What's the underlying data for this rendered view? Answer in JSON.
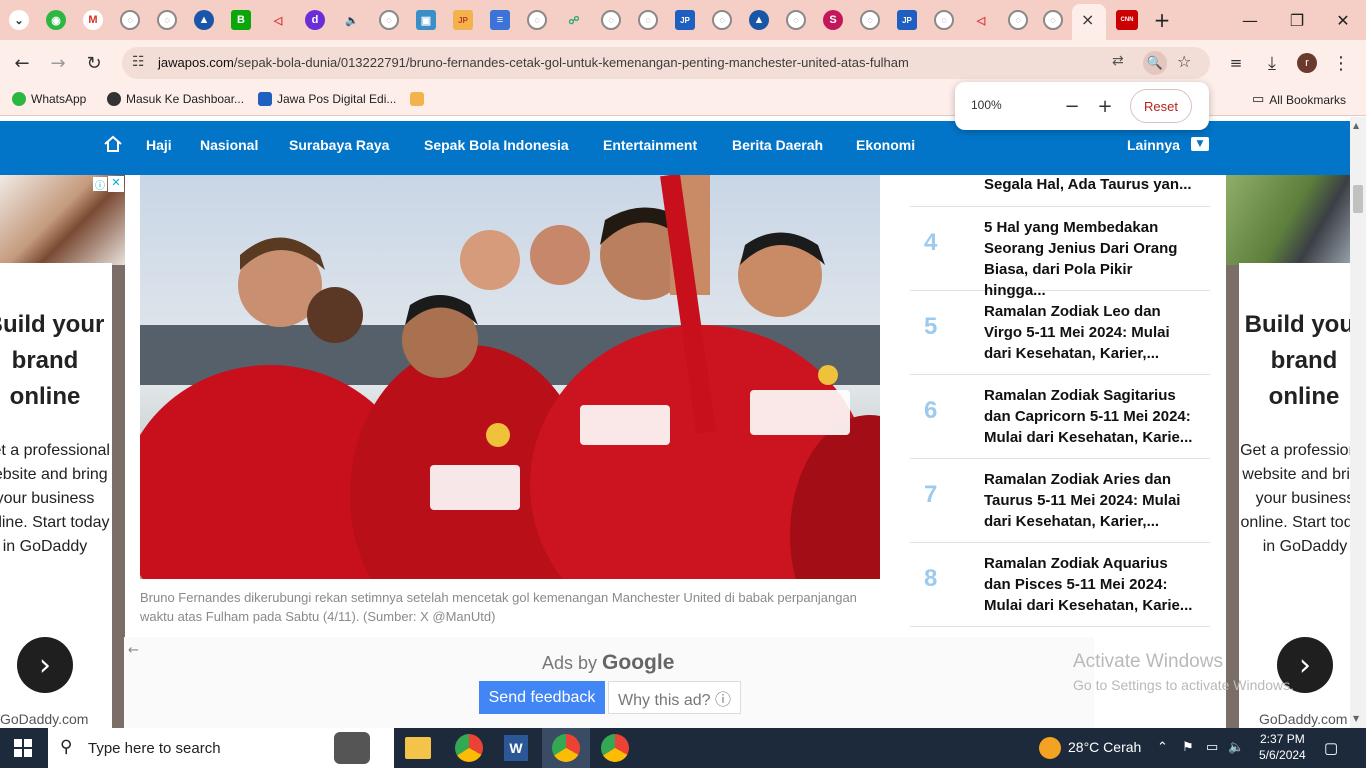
{
  "browser": {
    "active_tab_close": "×",
    "new_tab": "+",
    "tab_badges": [
      "B",
      "d",
      "JP",
      "S",
      "JP",
      "CNN"
    ],
    "url_host": "jawapos.com",
    "url_path": "/sepak-bola-dunia/013222791/bruno-fernandes-cetak-gol-untuk-kemenangan-penting-manchester-united-atas-fulham",
    "profile_initial": "r",
    "bookmarks": [
      "WhatsApp",
      "Masuk Ke Dashboar...",
      "Jawa Pos Digital Edi..."
    ],
    "all_bookmarks": "All Bookmarks",
    "zoom": {
      "level": "100%",
      "reset": "Reset"
    }
  },
  "nav": {
    "items": [
      "Haji",
      "Nasional",
      "Surabaya Raya",
      "Sepak Bola Indonesia",
      "Entertainment",
      "Berita Daerah",
      "Ekonomi"
    ],
    "more": "Lainnya"
  },
  "article": {
    "caption": "Bruno Fernandes dikerubungi rekan setimnya setelah mencetak gol kemenangan Manchester United di babak perpanjangan waktu atas Fulham pada Sabtu (4/11). (Sumber: X @ManUtd)"
  },
  "popular": {
    "partial_top": "Segala Hal, Ada Taurus yan...",
    "items": [
      {
        "num": "4",
        "title": "5 Hal yang Membedakan Seorang Jenius Dari Orang Biasa, dari Pola Pikir hingga..."
      },
      {
        "num": "5",
        "title": "Ramalan Zodiak Leo dan Virgo 5-11 Mei 2024: Mulai dari Kesehatan, Karier,..."
      },
      {
        "num": "6",
        "title": "Ramalan Zodiak Sagitarius dan Capricorn 5-11 Mei 2024: Mulai dari Kesehatan, Karie..."
      },
      {
        "num": "7",
        "title": "Ramalan Zodiak Aries dan Taurus 5-11 Mei 2024: Mulai dari Kesehatan, Karier,..."
      },
      {
        "num": "8",
        "title": "Ramalan Zodiak Aquarius dan Pisces 5-11 Mei 2024: Mulai dari Kesehatan, Karie..."
      }
    ]
  },
  "ads": {
    "headline": "Build your brand online",
    "body": "Get a professional website and bring your business online. Start today in GoDaddy",
    "domain": "GoDaddy.com",
    "ads_by": "Ads by",
    "google": "Google",
    "send_feedback": "Send feedback",
    "why_this_ad": "Why this ad? ⓘ"
  },
  "watermark": {
    "title": "Activate Windows",
    "subtitle": "Go to Settings to activate Windows."
  },
  "taskbar": {
    "search_placeholder": "Type here to search",
    "weather": "28°C  Cerah",
    "time": "2:37 PM",
    "date": "5/6/2024"
  }
}
